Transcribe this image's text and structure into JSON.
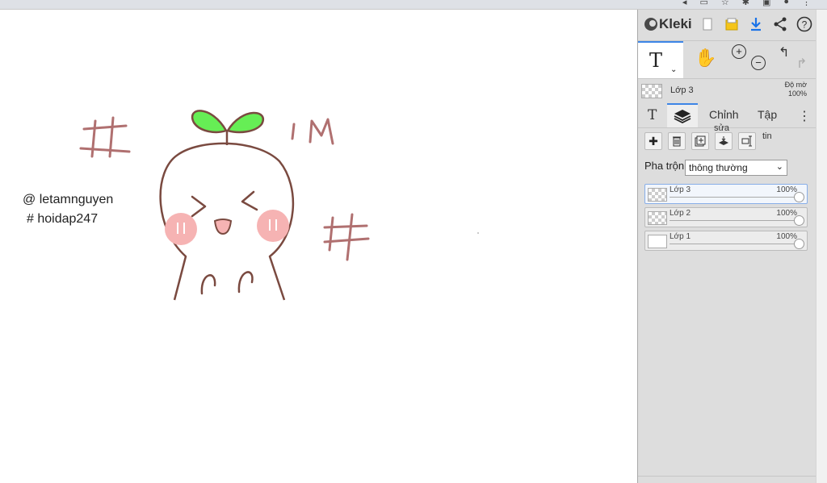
{
  "browser": {
    "icons": [
      "speaker-icon",
      "page-icon",
      "star-icon",
      "puzzle-icon",
      "window-icon",
      "avatar-icon",
      "menu-dots-icon"
    ]
  },
  "canvas": {
    "watermark_line1": "@ letamnguyen",
    "watermark_line2": "# hoidap247",
    "doodle_text": "IM",
    "stroke_color": "#b07070",
    "outline_color": "#7a4a40",
    "leaf_color": "#66ee55",
    "cheek_color": "#f6b3b3"
  },
  "app": {
    "logo": "Kleki",
    "top_icons": [
      "new-page-icon",
      "folder-icon",
      "download-icon",
      "share-icon",
      "help-icon"
    ],
    "tools": [
      "text-tool-icon",
      "hand-icon",
      "zoom-in-icon",
      "zoom-out-icon",
      "undo-icon",
      "redo-icon"
    ],
    "current_layer": {
      "name": "Lớp 3",
      "opacity_label": "Độ mờ",
      "opacity_value": "100%"
    },
    "tabs": {
      "text": "T",
      "edit": "Chỉnh",
      "file": "Tập",
      "more": "⋮"
    },
    "layer_actions": {
      "icons": [
        "add-layer-icon",
        "delete-layer-icon",
        "duplicate-layer-icon",
        "merge-down-icon",
        "rename-layer-icon"
      ],
      "note_over_merge": "sửa",
      "note_right": "tin"
    },
    "blend": {
      "label": "Pha trộn",
      "value": "thông thường"
    },
    "layers": [
      {
        "name": "Lớp 3",
        "opacity": "100%",
        "opacity_fraction": 1.0
      },
      {
        "name": "Lớp 2",
        "opacity": "100%",
        "opacity_fraction": 1.0
      },
      {
        "name": "Lớp 1",
        "opacity": "100%",
        "opacity_fraction": 1.0
      }
    ],
    "accent": "#3d85e6"
  }
}
